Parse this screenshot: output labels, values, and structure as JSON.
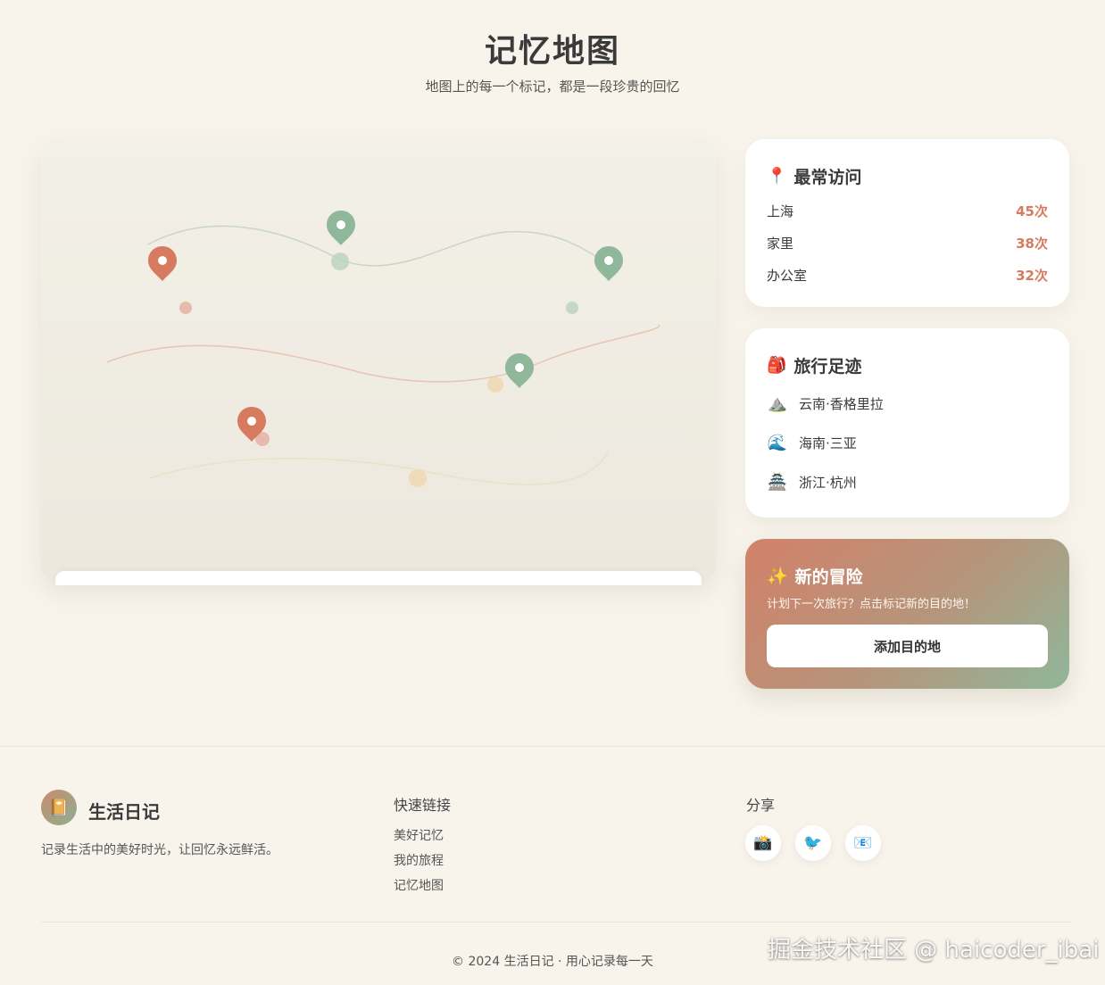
{
  "header": {
    "title": "记忆地图",
    "subtitle": "地图上的每一个标记，都是一段珍贵的回忆"
  },
  "map": {
    "marker_colors": {
      "coral": "#d67b5f",
      "sage": "#8fb79a"
    },
    "markers": [
      {
        "color": "coral"
      },
      {
        "color": "sage"
      },
      {
        "color": "sage"
      },
      {
        "color": "sage"
      },
      {
        "color": "coral"
      }
    ]
  },
  "most_visited": {
    "icon": "📍",
    "icon_name": "pin-icon",
    "title": "最常访问",
    "items": [
      {
        "place": "上海",
        "count": "45次"
      },
      {
        "place": "家里",
        "count": "38次"
      },
      {
        "place": "办公室",
        "count": "32次"
      }
    ]
  },
  "travel": {
    "icon": "🎒",
    "icon_name": "backpack-icon",
    "title": "旅行足迹",
    "items": [
      {
        "icon": "⛰️",
        "icon_name": "mountain-icon",
        "place": "云南·香格里拉"
      },
      {
        "icon": "🌊",
        "icon_name": "wave-icon",
        "place": "海南·三亚"
      },
      {
        "icon": "🏯",
        "icon_name": "castle-icon",
        "place": "浙江·杭州"
      }
    ]
  },
  "adventure": {
    "icon": "✨",
    "icon_name": "sparkles-icon",
    "title": "新的冒险",
    "description": "计划下一次旅行？点击标记新的目的地！",
    "button_label": "添加目的地"
  },
  "footer": {
    "brand_icon": "📔",
    "brand_name": "生活日记",
    "brand_desc": "记录生活中的美好时光，让回忆永远鲜活。",
    "links_heading": "快速链接",
    "links": [
      "美好记忆",
      "我的旅程",
      "记忆地图"
    ],
    "share_heading": "分享",
    "share_icons": [
      {
        "icon": "📸",
        "name": "camera-icon"
      },
      {
        "icon": "🐦",
        "name": "bird-icon"
      },
      {
        "icon": "📧",
        "name": "email-icon"
      }
    ],
    "copyright": "© 2024 生活日记 · 用心记录每一天"
  },
  "watermark": "掘金技术社区 @ haicoder_ibai"
}
